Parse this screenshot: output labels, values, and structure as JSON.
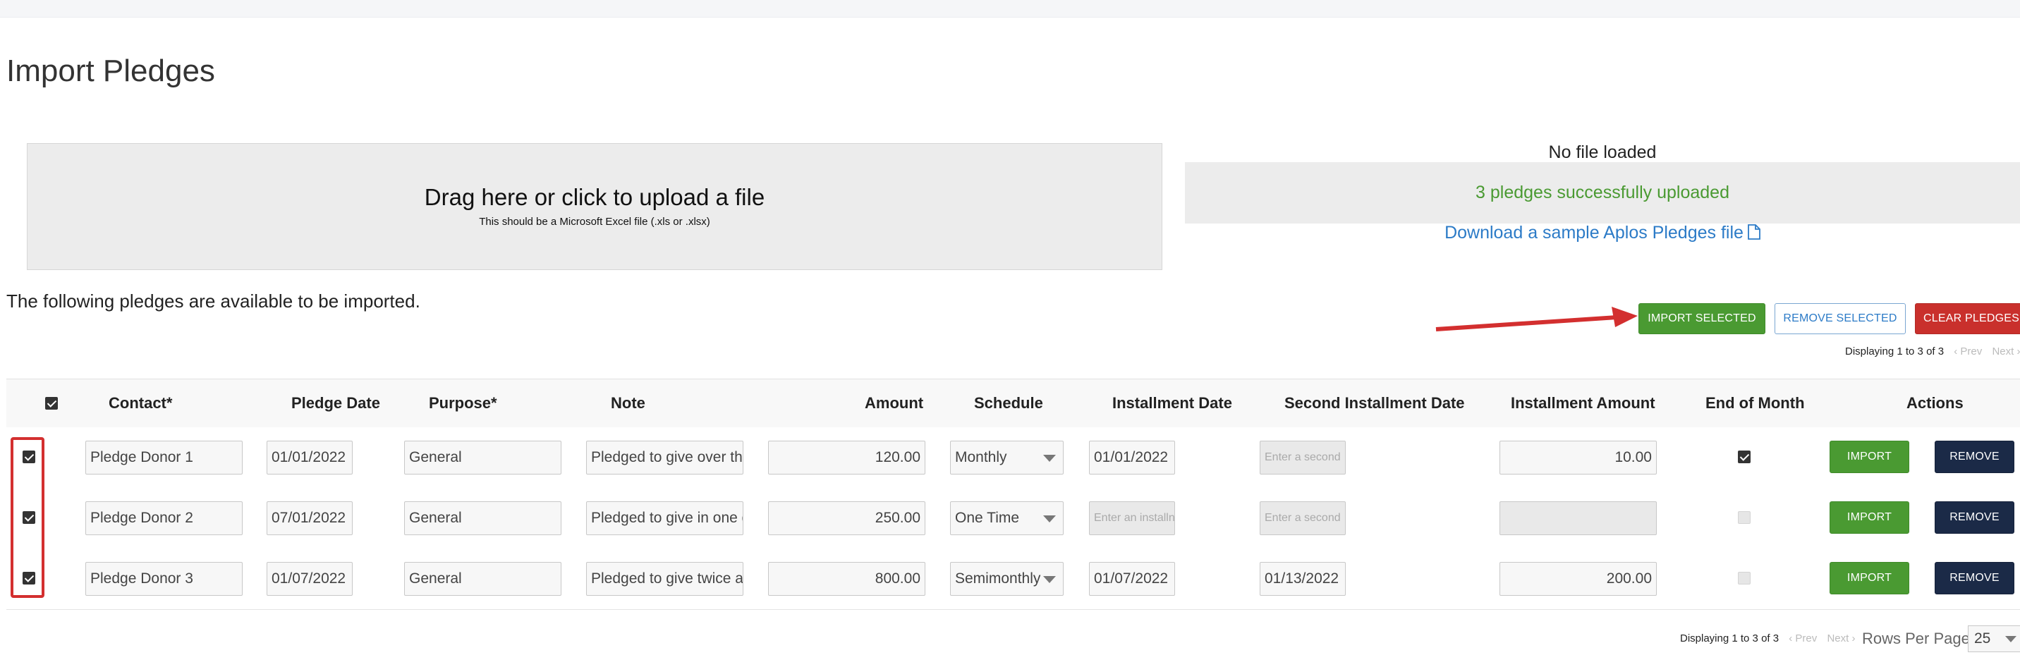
{
  "page": {
    "title": "Import Pledges"
  },
  "upload": {
    "title": "Drag here or click to upload a file",
    "subtitle": "This should be a Microsoft Excel file (.xls or .xlsx)"
  },
  "status": {
    "no_file": "No file loaded",
    "success": "3 pledges successfully uploaded",
    "sample_link": "Download a sample Aplos Pledges file"
  },
  "info_text": "The following pledges are available to be imported.",
  "toolbar": {
    "import_selected": "IMPORT SELECTED",
    "remove_selected": "REMOVE SELECTED",
    "clear_pledges": "CLEAR PLEDGES"
  },
  "pagination": {
    "displaying": "Displaying 1 to 3 of 3",
    "prev": "‹ Prev",
    "next": "Next ›",
    "rows_per_page_label": "Rows Per Page:",
    "rows_per_page_value": "25"
  },
  "table": {
    "headers": {
      "contact": "Contact*",
      "pledge_date": "Pledge Date",
      "purpose": "Purpose*",
      "note": "Note",
      "amount": "Amount",
      "schedule": "Schedule",
      "installment_date": "Installment Date",
      "second_installment_date": "Second Installment Date",
      "installment_amount": "Installment Amount",
      "end_of_month": "End of Month",
      "actions": "Actions"
    },
    "rows": [
      {
        "selected": true,
        "contact": "Pledge Donor 1",
        "pledge_date": "01/01/2022",
        "purpose": "General",
        "note": "Pledged to give over the",
        "amount": "120.00",
        "schedule": "Monthly",
        "installment_date": "01/01/2022",
        "second_installment_date_placeholder": "Enter a second",
        "installment_amount": "10.00",
        "end_of_month": true,
        "import_label": "IMPORT",
        "remove_label": "REMOVE"
      },
      {
        "selected": true,
        "contact": "Pledge Donor 2",
        "pledge_date": "07/01/2022",
        "purpose": "General",
        "note": "Pledged to give in one d",
        "amount": "250.00",
        "schedule": "One Time",
        "installment_date_placeholder": "Enter an installn",
        "second_installment_date_placeholder": "Enter a second",
        "installment_amount": "",
        "end_of_month": false,
        "import_label": "IMPORT",
        "remove_label": "REMOVE"
      },
      {
        "selected": true,
        "contact": "Pledge Donor 3",
        "pledge_date": "01/07/2022",
        "purpose": "General",
        "note": "Pledged to give twice a r",
        "amount": "800.00",
        "schedule": "Semimonthly",
        "installment_date": "01/07/2022",
        "second_installment_date": "01/13/2022",
        "installment_amount": "200.00",
        "end_of_month": false,
        "import_label": "IMPORT",
        "remove_label": "REMOVE"
      }
    ]
  },
  "colors": {
    "success_green": "#4a9a32",
    "link_blue": "#2c7bc7",
    "danger_red": "#c9302c",
    "navy": "#1b2a47",
    "annotation_red": "#d32f2f"
  },
  "icons": {
    "sample_file": "file-icon",
    "annotation": "red-arrow-annotation"
  }
}
